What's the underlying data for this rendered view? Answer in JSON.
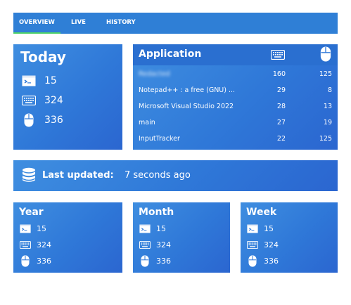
{
  "tabs": [
    "OVERVIEW",
    "LIVE",
    "HISTORY"
  ],
  "today": {
    "title": "Today",
    "terminal": "15",
    "keyboard": "324",
    "mouse": "336"
  },
  "application": {
    "title": "Application",
    "rows": [
      {
        "name": "Redacted",
        "kb": "160",
        "ms": "125"
      },
      {
        "name": "Notepad++ : a free (GNU) ...",
        "kb": "29",
        "ms": "8"
      },
      {
        "name": "Microsoft Visual Studio 2022",
        "kb": "28",
        "ms": "13"
      },
      {
        "name": "main",
        "kb": "27",
        "ms": "19"
      },
      {
        "name": "InputTracker",
        "kb": "22",
        "ms": "125"
      }
    ]
  },
  "status": {
    "label": "Last updated:",
    "text": "7 seconds ago"
  },
  "year": {
    "title": "Year",
    "terminal": "15",
    "keyboard": "324",
    "mouse": "336"
  },
  "month": {
    "title": "Month",
    "terminal": "15",
    "keyboard": "324",
    "mouse": "336"
  },
  "week": {
    "title": "Week",
    "terminal": "15",
    "keyboard": "324",
    "mouse": "336"
  },
  "icons": [
    "terminal-icon",
    "keyboard-icon",
    "mouse-icon",
    "database-icon"
  ],
  "colors": {
    "accent": "#2f7fd6",
    "tab_indicator": "#4fd36a"
  }
}
